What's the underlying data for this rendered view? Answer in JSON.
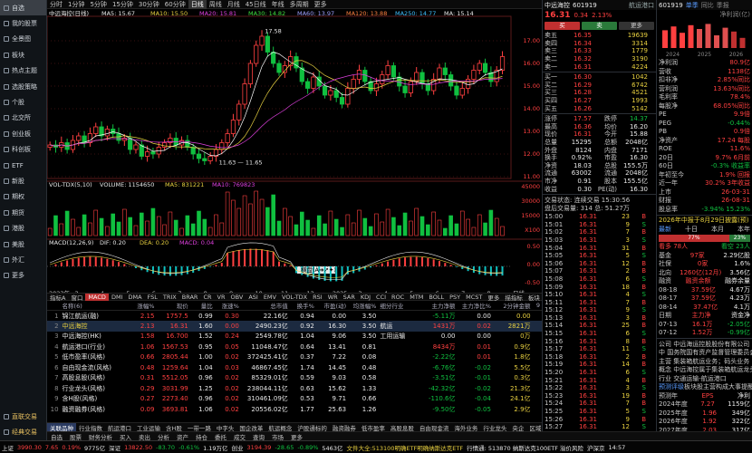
{
  "nav": [
    "自选",
    "我的股票",
    "全景图",
    "板块",
    "热点主题",
    "选股策略",
    "个股",
    "北交所",
    "创业板",
    "科创板",
    "ETF",
    "新股",
    "期权",
    "期货",
    "港股",
    "美股",
    "外汇",
    "更多"
  ],
  "nav_bottom": [
    "直联交易",
    "经典交易"
  ],
  "periods": [
    "分时",
    "1分钟",
    "5分钟",
    "15分钟",
    "30分钟",
    "60分钟",
    "日线",
    "周线",
    "月线",
    "45日线",
    "年线",
    "多周期",
    "更多"
  ],
  "main_legend": {
    "name": "中远海控(日线)",
    "ma5": "MA5: 15.67",
    "ma10": "MA10: 15.50",
    "ma20": "MA20: 15.81",
    "ma30": "MA30: 14.82",
    "ma60": "MA60: 13.97",
    "ma120": "MA120: 13.88",
    "ma250": "MA250: 14.77",
    "ma": "MA: 15.14"
  },
  "price_axis": [
    "17.00",
    "16.00",
    "15.00",
    "14.00",
    "13.00",
    "12.00",
    "11.00"
  ],
  "high_label": "17.58",
  "low_label": "11.63 — 11.65",
  "vol_legend": {
    "a": "VOL-TDX(5,10)",
    "b": "VOLUME: 1154650",
    "c": "MA5: 831221",
    "d": "MA10: 769823"
  },
  "vol_axis": [
    "45000",
    "30000",
    "15000",
    "X100"
  ],
  "macd_legend": {
    "a": "MACD(12,26,9)",
    "b": "DIF: 0.20",
    "c": "DEA: 0.20",
    "d": "MACD: 0.04"
  },
  "macd_axis": [
    "0.50",
    "0.00",
    "-0.50"
  ],
  "x_labels": [
    "2023年",
    "3",
    "4",
    "5",
    "6",
    "7",
    "8",
    "9",
    "10",
    "11",
    "12",
    "2025",
    "3",
    "4",
    "5",
    "6",
    "7",
    "8",
    "日线"
  ],
  "tooltip": "横盘(A➜↗✦)",
  "ind_tabs": [
    "指标A",
    "窗口",
    "MACD",
    "DMI",
    "DMA",
    "FSL",
    "TRIX",
    "BRAR",
    "CR",
    "VR",
    "OBV",
    "ASI",
    "EMV",
    "VOL-TDX",
    "RSI",
    "WR",
    "SAR",
    "KDJ",
    "CCI",
    "ROC",
    "MTM",
    "BOLL",
    "PSY",
    "MCST",
    "更多",
    "描指标",
    "板块",
    "模板"
  ],
  "table": {
    "headers": [
      "",
      "名称(6)",
      "涨幅%",
      "现价",
      "量比",
      "涨速%",
      "总市值",
      "换手%",
      "市盈(动)",
      "均涨幅%",
      "细分行业",
      "主力净额",
      "主力净比%",
      "2分钟金额",
      "9"
    ],
    "rows": [
      [
        "1",
        "锦江航运(融)",
        "2.15",
        "1757.5",
        "0.99",
        "0.30",
        "22.16亿",
        "0.94",
        "0.00",
        "3.50",
        "",
        "-5.11万",
        "0.00",
        "0.00",
        ""
      ],
      [
        "2",
        "中远海控",
        "2.13",
        "16.31",
        "1.60",
        "0.00",
        "2490.23亿",
        "0.92",
        "16.30",
        "3.50",
        "航运",
        "1431万",
        "0.02",
        "2821万",
        ""
      ],
      [
        "3",
        "中远海控(HK)",
        "1.58",
        "16.700",
        "1.52",
        "0.24",
        "2549.78亿",
        "1.04",
        "9.06",
        "3.50",
        "工用运输",
        "0.00",
        "0.00",
        "0万",
        ""
      ],
      [
        "4",
        "航运港口(行业)",
        "1.06",
        "1567.53",
        "0.95",
        "0.05",
        "11048.47亿",
        "0.64",
        "13.41",
        "0.81",
        "",
        "8434万",
        "0.01",
        "0.9亿",
        ""
      ],
      [
        "5",
        "低市盈率(风格)",
        "0.66",
        "2805.44",
        "1.00",
        "0.02",
        "372425.41亿",
        "0.37",
        "7.22",
        "0.08",
        "",
        "-2.22亿",
        "0.01",
        "1.8亿",
        ""
      ],
      [
        "6",
        "自由现金流(风格)",
        "0.48",
        "1259.64",
        "1.04",
        "0.03",
        "46867.45亿",
        "1.74",
        "14.45",
        "0.48",
        "",
        "-6.76亿",
        "-0.02",
        "5.5亿",
        ""
      ],
      [
        "7",
        "高股息股(风格)",
        "0.31",
        "5512.05",
        "0.96",
        "0.02",
        "85329.01亿",
        "0.59",
        "9.03",
        "0.58",
        "",
        "-3.51亿",
        "-0.01",
        "0.3亿",
        ""
      ],
      [
        "8",
        "行业龙头(风格)",
        "0.29",
        "3031.99",
        "1.25",
        "0.02",
        "238044.11亿",
        "0.63",
        "15.62",
        "1.33",
        "",
        "-42.32亿",
        "-0.02",
        "21.3亿",
        ""
      ],
      [
        "9",
        "含H股(风格)",
        "0.27",
        "2273.40",
        "0.96",
        "0.02",
        "310461.09亿",
        "0.53",
        "9.71",
        "0.66",
        "",
        "-110.6亿",
        "-0.04",
        "24.1亿",
        ""
      ],
      [
        "10",
        "融资融券(风格)",
        "0.09",
        "3693.81",
        "1.06",
        "0.02",
        "20556.02亿",
        "1.77",
        "25.63",
        "1.26",
        "",
        "-9.50亿",
        "-0.05",
        "2.9亿",
        ""
      ]
    ]
  },
  "bot_tabs": [
    "关联品种",
    "行业指数",
    "航运港口",
    "工业运输",
    "含H股",
    "一带一路",
    "中字头",
    "国企改革",
    "航运概念",
    "沪股通标的",
    "融资融券",
    "低市盈率",
    "高股息股",
    "自由现金流",
    "海外业务",
    "行业龙头",
    "央企",
    "区域",
    "上海",
    "北上重仓",
    "高机构",
    "定价",
    "策略",
    "财报选股",
    "提醒"
  ],
  "toolbar": [
    "自选",
    "股票",
    "财务分析",
    "买入",
    "卖出",
    "分析",
    "资产",
    "持仓",
    "委托",
    "成交",
    "查询",
    "市场",
    "更多"
  ],
  "status": [
    {
      "t": "上证",
      "c": "white"
    },
    {
      "t": "3990.30",
      "c": "red"
    },
    {
      "t": "7.65",
      "c": "red"
    },
    {
      "t": "0.19%",
      "c": "red"
    },
    {
      "t": "9775亿",
      "c": "white"
    },
    {
      "t": "深证",
      "c": "white"
    },
    {
      "t": "13822.50",
      "c": "red"
    },
    {
      "t": "-83.70",
      "c": "green"
    },
    {
      "t": "-0.61%",
      "c": "green"
    },
    {
      "t": "1.19万亿",
      "c": "white"
    },
    {
      "t": "创业",
      "c": "white"
    },
    {
      "t": "3194.39",
      "c": "red"
    },
    {
      "t": "-28.65",
      "c": "green"
    },
    {
      "t": "-0.89%",
      "c": "green"
    },
    {
      "t": "5463亿",
      "c": "white"
    },
    {
      "t": "文件大全:513100明确ETF明确纳斯达克ETF",
      "c": "yellow"
    },
    {
      "t": "行情通: 513870 纳斯达克100ETF 溢价风险",
      "c": "white"
    },
    {
      "t": "沪深京",
      "c": "white"
    },
    {
      "t": "14:57",
      "c": "white"
    }
  ],
  "quote": {
    "name": "中远海控",
    "code": "601919",
    "tag": "航运港口",
    "price": "16.31",
    "chg": "0.34",
    "pct": "2.13%",
    "buy_btn": "买",
    "sell_btn": "卖",
    "more_btn": "更多"
  },
  "asks": [
    [
      "卖五",
      "16.35",
      "19639"
    ],
    [
      "卖四",
      "16.34",
      "3314"
    ],
    [
      "卖三",
      "16.33",
      "1779"
    ],
    [
      "卖二",
      "16.32",
      "3190"
    ],
    [
      "卖一",
      "16.31",
      "4224"
    ]
  ],
  "bids": [
    [
      "买一",
      "16.30",
      "1042"
    ],
    [
      "买二",
      "16.29",
      "6742"
    ],
    [
      "买三",
      "16.28",
      "4521"
    ],
    [
      "买四",
      "16.27",
      "1993"
    ],
    [
      "买五",
      "16.26",
      "5142"
    ]
  ],
  "stats": [
    [
      "涨停",
      "17.57",
      "跌停",
      "14.37"
    ],
    [
      "最高",
      "16.36",
      "均价",
      "16.20"
    ],
    [
      "现价",
      "16.31",
      "今开",
      "15.88"
    ],
    [
      "总量",
      "15295",
      "总额",
      "2048亿"
    ],
    [
      "外盘",
      "8124",
      "内盘",
      "7171"
    ],
    [
      "换手",
      "0.92%",
      "市盈",
      "16.30"
    ],
    [
      "净资",
      "18.03",
      "总股",
      "155.5万"
    ],
    [
      "流通",
      "63002",
      "流通",
      "2048亿"
    ],
    [
      "市净",
      "0.91",
      "股本",
      "155.5亿"
    ],
    [
      "收益",
      "0.30",
      "PE(动)",
      "16.30"
    ]
  ],
  "trade_status": "交易状态: 连续交易 15:30:56",
  "trade_vol": "盘后交易量: 314 总: 51.27万",
  "ticks": [
    [
      "15:00",
      "16.31",
      "23",
      "B"
    ],
    [
      "15:01",
      "16.31",
      "9",
      "S"
    ],
    [
      "15:02",
      "16.31",
      "7",
      "B"
    ],
    [
      "15:03",
      "16.31",
      "3",
      "S"
    ],
    [
      "15:04",
      "16.31",
      "31",
      "B"
    ],
    [
      "15:05",
      "16.31",
      "5",
      "S"
    ],
    [
      "15:06",
      "16.31",
      "12",
      "B"
    ],
    [
      "15:07",
      "16.31",
      "2",
      "B"
    ],
    [
      "15:08",
      "16.31",
      "6",
      "S"
    ],
    [
      "15:09",
      "16.31",
      "18",
      "B"
    ],
    [
      "15:10",
      "16.31",
      "4",
      "S"
    ],
    [
      "15:11",
      "16.31",
      "7",
      "B"
    ],
    [
      "15:12",
      "16.31",
      "9",
      "S"
    ],
    [
      "15:13",
      "16.31",
      "3",
      "B"
    ],
    [
      "15:14",
      "16.31",
      "25",
      "B"
    ],
    [
      "15:15",
      "16.31",
      "6",
      "S"
    ],
    [
      "15:16",
      "16.31",
      "8",
      "B"
    ],
    [
      "15:17",
      "16.31",
      "11",
      "S"
    ],
    [
      "15:18",
      "16.31",
      "2",
      "B"
    ],
    [
      "15:19",
      "16.31",
      "14",
      "B"
    ],
    [
      "15:20",
      "16.31",
      "6",
      "S"
    ],
    [
      "15:21",
      "16.31",
      "4",
      "B"
    ],
    [
      "15:22",
      "16.31",
      "3",
      "S"
    ],
    [
      "15:23",
      "16.31",
      "19",
      "B"
    ],
    [
      "15:24",
      "16.31",
      "7",
      "B"
    ],
    [
      "15:25",
      "16.31",
      "5",
      "S"
    ],
    [
      "15:26",
      "16.31",
      "9",
      "B"
    ],
    [
      "15:27",
      "16.31",
      "12",
      "S"
    ],
    [
      "15:28",
      "16.31",
      "8",
      "B"
    ],
    [
      "15:29",
      "16.31",
      "3",
      "B"
    ],
    [
      "15:30",
      "16.31",
      "6",
      "S"
    ]
  ],
  "r2": {
    "code": "601919",
    "tabs": [
      "单季",
      "同比",
      "季报"
    ],
    "tag": "净利润(亿)",
    "bar_years": [
      "2024",
      "2025",
      "2026"
    ],
    "rows1": [
      [
        "净利润",
        "80.9亿"
      ],
      [
        "营收",
        "1138亿"
      ],
      [
        "扣非净",
        "2.85%同比"
      ],
      [
        "营利润",
        "13.63%同比"
      ],
      [
        "毛利率",
        "78.4%"
      ],
      [
        "每股净",
        "68.05%同比"
      ],
      [
        "PE",
        "9.9倍"
      ],
      [
        "PEG",
        "-0.44%"
      ],
      [
        "PB",
        "0.9倍"
      ],
      [
        "净资产",
        "17.24 每股"
      ],
      [
        "ROE",
        "11.6%"
      ],
      [
        "20日",
        "9.7% 6月前"
      ],
      [
        "60日",
        "-0.3% 收益率"
      ],
      [
        "年初至今",
        "1.9% 回报"
      ],
      [
        "近一年",
        "30.2% 3年收益"
      ],
      [
        "上市",
        "26-03-31"
      ],
      [
        "财报",
        "26-08-31"
      ],
      [
        "股息率",
        "-3.94% 15.23%"
      ]
    ],
    "rating_title": "2026年中报于8月29日披露(预)",
    "rating_tabs": [
      "最新",
      "十日",
      "本月",
      "本年"
    ],
    "rating_bar": {
      "a": "77%",
      "b": "23%",
      "a_label": "看多 78人",
      "b_label": "看空 23人"
    },
    "rows2": [
      [
        "基金",
        "97家",
        "2.29亿股"
      ],
      [
        "社保",
        "0家",
        "1.6%"
      ],
      [
        "北向",
        "1260亿(12月)",
        "3.56亿"
      ],
      [
        "融资",
        "融资余额",
        "融券余量"
      ],
      [
        "08-18",
        "37.59亿",
        "4.67万"
      ],
      [
        "08-17",
        "37.59亿",
        "4.23万"
      ],
      [
        "08-14",
        "37.47亿",
        "4.1万"
      ]
    ],
    "rows3": [
      [
        "日期",
        "主力净",
        "资金净"
      ],
      [
        "07-13",
        "16.1万",
        "-2.05亿"
      ],
      [
        "07-12",
        "1.52万",
        "-0.99亿"
      ]
    ],
    "company": [
      "公司 中远海运控股股份有限公司",
      "中 国务院国有资产监督管理委员会",
      "主营 集装箱航运业务；码头业务",
      "概念 中远海控属于集装箱航运龙头",
      "行业 交通运输-航运港口"
    ],
    "forecast_tabs": [
      "预测评级",
      "板块股",
      "主营构成",
      "大事提醒"
    ],
    "forecast": [
      [
        "预测年",
        "EPS",
        "净利"
      ],
      [
        "2024年度",
        "7.27",
        "1159亿"
      ],
      [
        "2025年度",
        "1.96",
        "349亿"
      ],
      [
        "2026年度",
        "1.92",
        "322亿"
      ],
      [
        "2027年度",
        "2.03",
        "317亿"
      ]
    ]
  },
  "colors": {
    "up": "#ff4040",
    "down": "#10c040",
    "bg": "#000000"
  },
  "chart_data": [
    {
      "type": "candlestick",
      "title": "中远海控(日线)",
      "ylim": [
        11,
        18
      ],
      "y_ticks": [
        11,
        12,
        13,
        14,
        15,
        16,
        17
      ],
      "series": [
        {
          "name": "MA5",
          "color": "#ffffff"
        },
        {
          "name": "MA10",
          "color": "#e8d040"
        },
        {
          "name": "MA20",
          "color": "#e040e0"
        },
        {
          "name": "MA30",
          "color": "#40e040"
        },
        {
          "name": "MA60",
          "color": "#a0a0ff"
        }
      ],
      "closes": [
        12.4,
        12.3,
        12.5,
        12.2,
        12.6,
        12.8,
        12.5,
        12.9,
        13.2,
        12.8,
        13.1,
        12.9,
        12.6,
        12.7,
        12.2,
        12.4,
        11.9,
        12.1,
        12.0,
        12.3,
        12.5,
        12.7,
        12.4,
        12.6,
        12.3,
        12.0,
        11.8,
        11.7,
        11.9,
        12.2,
        12.5,
        12.9,
        13.5,
        14.2,
        15.1,
        16.0,
        16.8,
        17.2,
        16.5,
        16.0,
        15.6,
        15.9,
        16.3,
        15.8,
        15.2,
        14.9,
        15.4,
        15.0,
        14.6,
        14.8,
        14.5,
        14.2,
        14.9,
        15.3,
        15.7,
        15.2,
        14.8,
        15.1,
        15.5,
        15.9,
        15.4,
        15.0,
        14.7,
        15.2,
        15.6,
        15.1,
        14.8,
        15.3,
        15.8,
        15.5,
        15.0,
        14.6,
        14.9,
        15.3,
        15.7,
        16.0,
        15.6,
        15.2,
        15.7,
        16.3
      ]
    },
    {
      "type": "bar",
      "title": "VOL-TDX(5,10)",
      "ylim": [
        0,
        50000
      ],
      "y_ticks": [
        15000,
        30000,
        45000
      ]
    },
    {
      "type": "bar",
      "title": "MACD(12,26,9)",
      "ylim": [
        -0.7,
        0.7
      ],
      "y_ticks": [
        -0.5,
        0,
        0.5
      ]
    }
  ]
}
